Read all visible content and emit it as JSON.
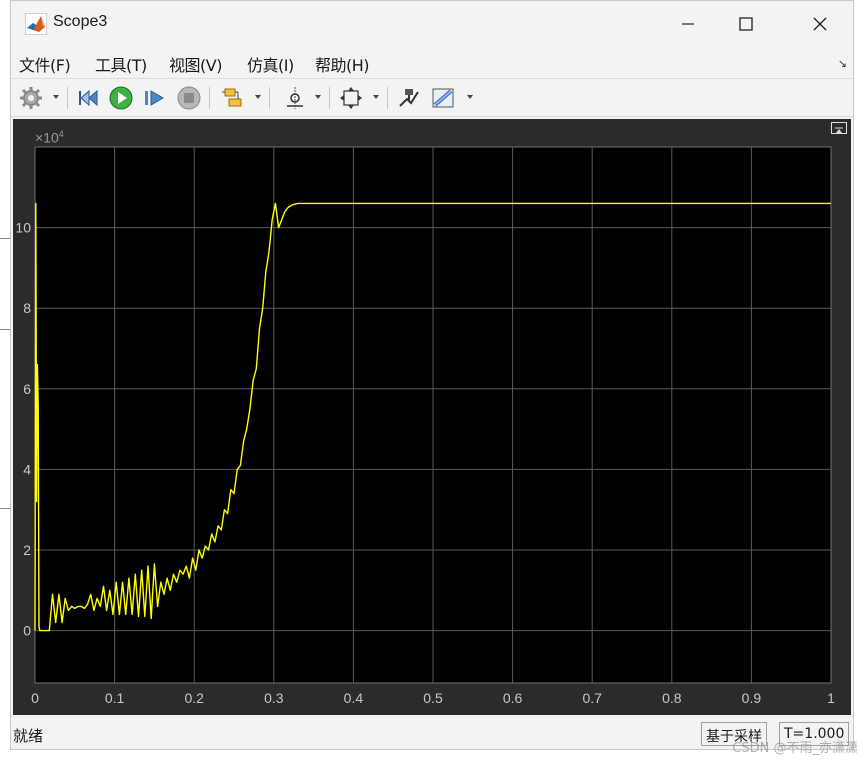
{
  "window": {
    "title": "Scope3",
    "controls": {
      "minimize": "minimize-icon",
      "maximize": "maximize-icon",
      "close": "close-icon"
    }
  },
  "menu": {
    "items": [
      "文件(F)",
      "工具(T)",
      "视图(V)",
      "仿真(I)",
      "帮助(H)"
    ]
  },
  "toolbar": {
    "icons": [
      "gear-icon",
      "step-back-icon",
      "run-icon",
      "step-forward-icon",
      "stop-icon",
      "signal-selector-icon",
      "cursor-measure-icon",
      "zoom-extents-icon",
      "highlight-block-icon",
      "style-icon"
    ]
  },
  "colors": {
    "plot_bg": "#000000",
    "frame_bg": "#2b2b2b",
    "grid": "#5a5a5a",
    "trace": "#ffff00",
    "tick_label": "#c8c8c8",
    "run_green": "#3cb043"
  },
  "chart_data": {
    "type": "line",
    "title": "",
    "xlabel": "",
    "ylabel": "",
    "y_exponent_label": "×10",
    "y_exponent_power": "4",
    "xlim": [
      0,
      1
    ],
    "ylim": [
      -1.3,
      12
    ],
    "xticks": [
      "0",
      "0.1",
      "0.2",
      "0.3",
      "0.4",
      "0.5",
      "0.6",
      "0.7",
      "0.8",
      "0.9",
      "1"
    ],
    "yticks": [
      "0",
      "2",
      "4",
      "6",
      "8",
      "10"
    ],
    "grid": true,
    "series": [
      {
        "values_note": "",
        "x": [
          0,
          0.001,
          0.002,
          0.003,
          0.004,
          0.005,
          0.006,
          0.008,
          0.012,
          0.018,
          0.022,
          0.026,
          0.03,
          0.034,
          0.038,
          0.042,
          0.046,
          0.05,
          0.054,
          0.058,
          0.062,
          0.066,
          0.07,
          0.074,
          0.078,
          0.082,
          0.086,
          0.09,
          0.094,
          0.098,
          0.102,
          0.106,
          0.11,
          0.114,
          0.118,
          0.122,
          0.126,
          0.13,
          0.134,
          0.138,
          0.142,
          0.146,
          0.15,
          0.154,
          0.158,
          0.162,
          0.166,
          0.17,
          0.174,
          0.178,
          0.182,
          0.186,
          0.19,
          0.194,
          0.198,
          0.202,
          0.206,
          0.21,
          0.214,
          0.218,
          0.222,
          0.226,
          0.23,
          0.234,
          0.238,
          0.242,
          0.246,
          0.25,
          0.254,
          0.258,
          0.262,
          0.266,
          0.27,
          0.274,
          0.278,
          0.282,
          0.286,
          0.29,
          0.294,
          0.298,
          0.302,
          0.306,
          0.31,
          0.314,
          0.318,
          0.322,
          0.326,
          0.33,
          0.334,
          0.338,
          0.342,
          0.346,
          0.35,
          0.356,
          0.362,
          0.37,
          0.38,
          0.4,
          0.45,
          0.5,
          0.6,
          0.7,
          0.8,
          0.9,
          1.0
        ],
        "y": [
          0,
          10.6,
          3.2,
          6.6,
          5.6,
          0.1,
          0,
          0,
          0,
          0,
          0.9,
          0.2,
          0.9,
          0.2,
          0.8,
          0.5,
          0.6,
          0.55,
          0.6,
          0.6,
          0.55,
          0.65,
          0.9,
          0.5,
          0.8,
          0.6,
          1.1,
          0.5,
          1.0,
          0.4,
          1.2,
          0.4,
          1.2,
          0.4,
          1.3,
          0.4,
          1.4,
          0.35,
          1.5,
          0.35,
          1.6,
          0.3,
          1.65,
          0.6,
          1.2,
          0.9,
          1.3,
          1.0,
          1.4,
          1.2,
          1.5,
          1.4,
          1.6,
          1.3,
          1.8,
          1.5,
          2.0,
          1.8,
          2.1,
          2.0,
          2.4,
          2.2,
          2.6,
          2.5,
          3.0,
          2.9,
          3.5,
          3.4,
          4.0,
          4.1,
          4.7,
          5.0,
          5.5,
          6.2,
          6.5,
          7.5,
          8.0,
          8.9,
          9.4,
          10.2,
          10.6,
          10.0,
          10.2,
          10.4,
          10.5,
          10.55,
          10.58,
          10.6,
          10.6,
          10.6,
          10.6,
          10.6,
          10.6,
          10.6,
          10.6,
          10.6,
          10.6,
          10.6,
          10.6,
          10.6,
          10.6,
          10.6,
          10.6,
          10.6,
          10.6
        ]
      }
    ]
  },
  "status": {
    "ready": "就绪",
    "mode": "基于采样",
    "time": "T=1.000",
    "watermark": "CSDN @不雨_亦潇潇"
  }
}
